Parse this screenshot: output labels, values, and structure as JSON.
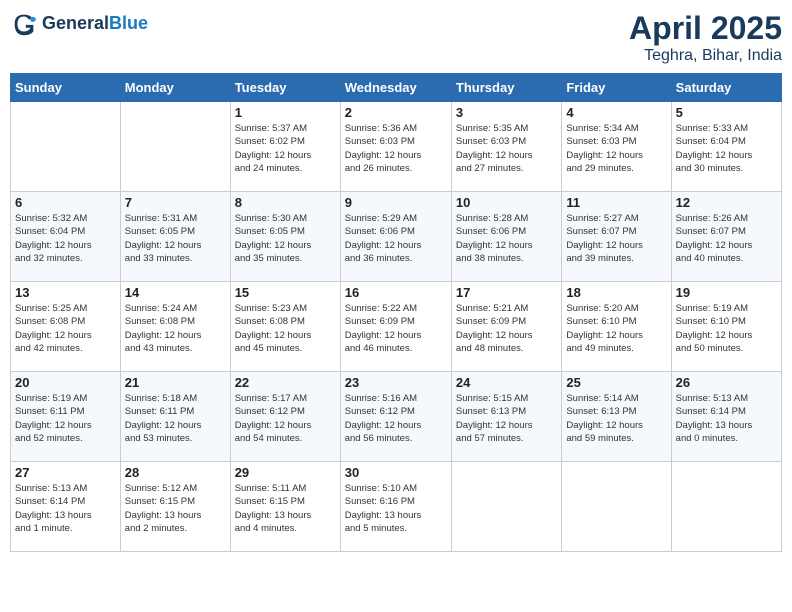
{
  "header": {
    "logo_line1": "General",
    "logo_line2": "Blue",
    "title": "April 2025",
    "subtitle": "Teghra, Bihar, India"
  },
  "calendar": {
    "days_of_week": [
      "Sunday",
      "Monday",
      "Tuesday",
      "Wednesday",
      "Thursday",
      "Friday",
      "Saturday"
    ],
    "weeks": [
      [
        {
          "day": "",
          "info": ""
        },
        {
          "day": "",
          "info": ""
        },
        {
          "day": "1",
          "info": "Sunrise: 5:37 AM\nSunset: 6:02 PM\nDaylight: 12 hours\nand 24 minutes."
        },
        {
          "day": "2",
          "info": "Sunrise: 5:36 AM\nSunset: 6:03 PM\nDaylight: 12 hours\nand 26 minutes."
        },
        {
          "day": "3",
          "info": "Sunrise: 5:35 AM\nSunset: 6:03 PM\nDaylight: 12 hours\nand 27 minutes."
        },
        {
          "day": "4",
          "info": "Sunrise: 5:34 AM\nSunset: 6:03 PM\nDaylight: 12 hours\nand 29 minutes."
        },
        {
          "day": "5",
          "info": "Sunrise: 5:33 AM\nSunset: 6:04 PM\nDaylight: 12 hours\nand 30 minutes."
        }
      ],
      [
        {
          "day": "6",
          "info": "Sunrise: 5:32 AM\nSunset: 6:04 PM\nDaylight: 12 hours\nand 32 minutes."
        },
        {
          "day": "7",
          "info": "Sunrise: 5:31 AM\nSunset: 6:05 PM\nDaylight: 12 hours\nand 33 minutes."
        },
        {
          "day": "8",
          "info": "Sunrise: 5:30 AM\nSunset: 6:05 PM\nDaylight: 12 hours\nand 35 minutes."
        },
        {
          "day": "9",
          "info": "Sunrise: 5:29 AM\nSunset: 6:06 PM\nDaylight: 12 hours\nand 36 minutes."
        },
        {
          "day": "10",
          "info": "Sunrise: 5:28 AM\nSunset: 6:06 PM\nDaylight: 12 hours\nand 38 minutes."
        },
        {
          "day": "11",
          "info": "Sunrise: 5:27 AM\nSunset: 6:07 PM\nDaylight: 12 hours\nand 39 minutes."
        },
        {
          "day": "12",
          "info": "Sunrise: 5:26 AM\nSunset: 6:07 PM\nDaylight: 12 hours\nand 40 minutes."
        }
      ],
      [
        {
          "day": "13",
          "info": "Sunrise: 5:25 AM\nSunset: 6:08 PM\nDaylight: 12 hours\nand 42 minutes."
        },
        {
          "day": "14",
          "info": "Sunrise: 5:24 AM\nSunset: 6:08 PM\nDaylight: 12 hours\nand 43 minutes."
        },
        {
          "day": "15",
          "info": "Sunrise: 5:23 AM\nSunset: 6:08 PM\nDaylight: 12 hours\nand 45 minutes."
        },
        {
          "day": "16",
          "info": "Sunrise: 5:22 AM\nSunset: 6:09 PM\nDaylight: 12 hours\nand 46 minutes."
        },
        {
          "day": "17",
          "info": "Sunrise: 5:21 AM\nSunset: 6:09 PM\nDaylight: 12 hours\nand 48 minutes."
        },
        {
          "day": "18",
          "info": "Sunrise: 5:20 AM\nSunset: 6:10 PM\nDaylight: 12 hours\nand 49 minutes."
        },
        {
          "day": "19",
          "info": "Sunrise: 5:19 AM\nSunset: 6:10 PM\nDaylight: 12 hours\nand 50 minutes."
        }
      ],
      [
        {
          "day": "20",
          "info": "Sunrise: 5:19 AM\nSunset: 6:11 PM\nDaylight: 12 hours\nand 52 minutes."
        },
        {
          "day": "21",
          "info": "Sunrise: 5:18 AM\nSunset: 6:11 PM\nDaylight: 12 hours\nand 53 minutes."
        },
        {
          "day": "22",
          "info": "Sunrise: 5:17 AM\nSunset: 6:12 PM\nDaylight: 12 hours\nand 54 minutes."
        },
        {
          "day": "23",
          "info": "Sunrise: 5:16 AM\nSunset: 6:12 PM\nDaylight: 12 hours\nand 56 minutes."
        },
        {
          "day": "24",
          "info": "Sunrise: 5:15 AM\nSunset: 6:13 PM\nDaylight: 12 hours\nand 57 minutes."
        },
        {
          "day": "25",
          "info": "Sunrise: 5:14 AM\nSunset: 6:13 PM\nDaylight: 12 hours\nand 59 minutes."
        },
        {
          "day": "26",
          "info": "Sunrise: 5:13 AM\nSunset: 6:14 PM\nDaylight: 13 hours\nand 0 minutes."
        }
      ],
      [
        {
          "day": "27",
          "info": "Sunrise: 5:13 AM\nSunset: 6:14 PM\nDaylight: 13 hours\nand 1 minute."
        },
        {
          "day": "28",
          "info": "Sunrise: 5:12 AM\nSunset: 6:15 PM\nDaylight: 13 hours\nand 2 minutes."
        },
        {
          "day": "29",
          "info": "Sunrise: 5:11 AM\nSunset: 6:15 PM\nDaylight: 13 hours\nand 4 minutes."
        },
        {
          "day": "30",
          "info": "Sunrise: 5:10 AM\nSunset: 6:16 PM\nDaylight: 13 hours\nand 5 minutes."
        },
        {
          "day": "",
          "info": ""
        },
        {
          "day": "",
          "info": ""
        },
        {
          "day": "",
          "info": ""
        }
      ]
    ]
  }
}
